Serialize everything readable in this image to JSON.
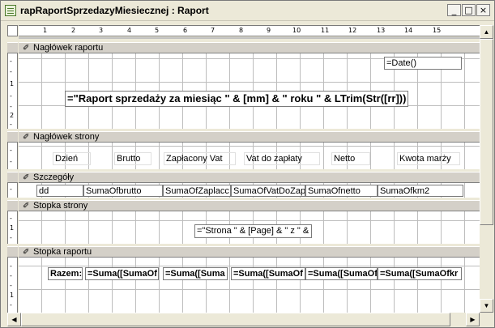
{
  "window": {
    "title": "rapRaportSprzedazyMiesiecznej : Raport",
    "controls": {
      "minimize": "_",
      "maximize": "□",
      "close": "×"
    }
  },
  "ruler": {
    "numbers": [
      "1",
      "2",
      "3",
      "4",
      "5",
      "6",
      "7",
      "8",
      "9",
      "10",
      "11",
      "12",
      "13",
      "14",
      "15"
    ],
    "vertical_1": [
      "-",
      "-",
      "1",
      "-",
      "-",
      "2",
      "-"
    ],
    "vertical_2": [
      "-",
      "-"
    ],
    "vertical_3": [
      "-"
    ],
    "vertical_4": [
      "-",
      "1",
      "-"
    ],
    "vertical_5": [
      "-",
      "-",
      "-",
      "1",
      "-"
    ]
  },
  "sections": {
    "report_header": "Nagłówek raportu",
    "page_header": "Nagłówek strony",
    "detail": "Szczegóły",
    "page_footer": "Stopka strony",
    "report_footer": "Stopka raportu"
  },
  "report_header": {
    "date": "=Date()",
    "title_expr": "=\"Raport sprzedaży za miesiąc \" & [mm] & \" roku \" & LTrim(Str([rr]))"
  },
  "page_header": {
    "labels": [
      "Dzień",
      "Brutto",
      "Zapłacony Vat",
      "Vat do zapłaty",
      "Netto",
      "Kwota marży"
    ]
  },
  "detail": {
    "fields": [
      "dd",
      "SumaOfbrutto",
      "SumaOfZaplacc",
      "SumaOfVatDoZapl",
      "SumaOfnetto",
      "SumaOfkm2"
    ]
  },
  "page_footer": {
    "page_expr": "=\"Strona \" & [Page] & \" z  \" &"
  },
  "report_footer": {
    "label": "Razem:",
    "fields": [
      "=Suma([SumaOf",
      "=Suma([Suma",
      "=Suma([SumaOf",
      "=Suma([SumaOf",
      "=Suma([SumaOfkr"
    ]
  },
  "scroll_icons": {
    "up": "▲",
    "down": "▼",
    "left": "◀",
    "right": "▶"
  },
  "section_icon": "pencil-icon"
}
